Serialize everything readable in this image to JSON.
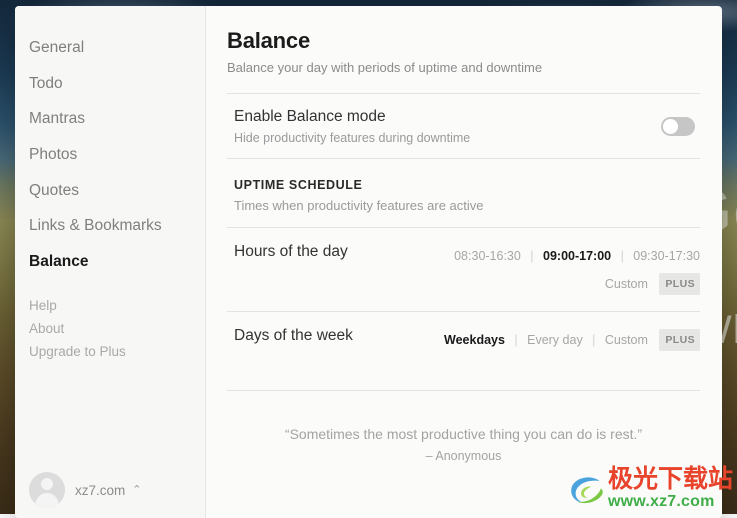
{
  "sidebar": {
    "main_items": [
      {
        "label": "General",
        "active": false
      },
      {
        "label": "Todo",
        "active": false
      },
      {
        "label": "Mantras",
        "active": false
      },
      {
        "label": "Photos",
        "active": false
      },
      {
        "label": "Quotes",
        "active": false
      },
      {
        "label": "Links & Bookmarks",
        "active": false
      },
      {
        "label": "Balance",
        "active": true
      }
    ],
    "secondary_items": [
      {
        "label": "Help"
      },
      {
        "label": "About"
      },
      {
        "label": "Upgrade to Plus"
      }
    ],
    "account": {
      "name": "xz7.com",
      "chevron": "⌃"
    }
  },
  "content": {
    "title": "Balance",
    "subtitle": "Balance your day with periods of uptime and downtime",
    "enable_row": {
      "label": "Enable Balance mode",
      "description": "Hide productivity features during downtime",
      "toggle_state": "off"
    },
    "section": {
      "title": "UPTIME SCHEDULE",
      "description": "Times when productivity features are active"
    },
    "rows": [
      {
        "label": "Hours of the day",
        "options": [
          {
            "text": "08:30-16:30",
            "selected": false,
            "plus": false
          },
          {
            "text": "09:00-17:00",
            "selected": true,
            "plus": false
          },
          {
            "text": "09:30-17:30",
            "selected": false,
            "plus": false
          },
          {
            "text": "Custom",
            "selected": false,
            "plus": true
          }
        ]
      },
      {
        "label": "Days of the week",
        "options": [
          {
            "text": "Weekdays",
            "selected": true,
            "plus": false
          },
          {
            "text": "Every day",
            "selected": false,
            "plus": false
          },
          {
            "text": "Custom",
            "selected": false,
            "plus": true
          }
        ]
      }
    ],
    "plus_badge_label": "PLUS",
    "separator": "|",
    "quote": {
      "text": "“Sometimes the most productive thing you can do is rest.”",
      "author": "– Anonymous"
    }
  },
  "background": {
    "ghost_greeting": "Go",
    "ghost_question": "Wh"
  },
  "watermark": {
    "cn_text": "极光下载站",
    "url_text": "www.xz7.com",
    "cn_color": "#e8442c",
    "url_color": "#3fae49"
  }
}
